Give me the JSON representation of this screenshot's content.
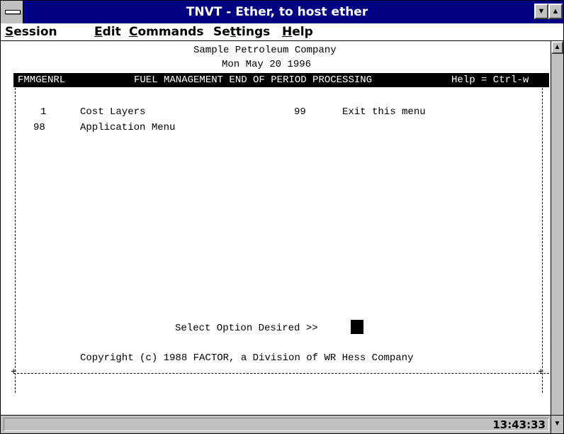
{
  "window": {
    "title": "TNVT - Ether, to host ether",
    "minimize_glyph": "▼",
    "maximize_glyph": "▲"
  },
  "menubar": {
    "items": [
      {
        "accel": "S",
        "rest": "ession"
      },
      {
        "accel": "E",
        "rest": "dit"
      },
      {
        "accel": "C",
        "rest": "ommands"
      },
      {
        "pre": "Se",
        "accel": "t",
        "rest": "tings"
      },
      {
        "accel": "H",
        "rest": "elp"
      }
    ]
  },
  "terminal": {
    "company": "Sample Petroleum Company",
    "date": "Mon May 20 1996",
    "header": {
      "program": "FMMGENRL",
      "title": "FUEL MANAGEMENT END OF PERIOD PROCESSING",
      "help": "Help = Ctrl-w"
    },
    "options": [
      {
        "num": "1",
        "label": "Cost Layers"
      },
      {
        "num": "99",
        "label": "Exit this menu"
      },
      {
        "num": "98",
        "label": "Application Menu"
      }
    ],
    "prompt": "Select Option Desired >>",
    "copyright": "Copyright (c) 1988 FACTOR, a Division of WR Hess Company",
    "pipe": "|",
    "plus": "+"
  },
  "scrollbar": {
    "up_glyph": "▲",
    "down_glyph": "▼"
  },
  "statusbar": {
    "clock": "13:43:33"
  }
}
